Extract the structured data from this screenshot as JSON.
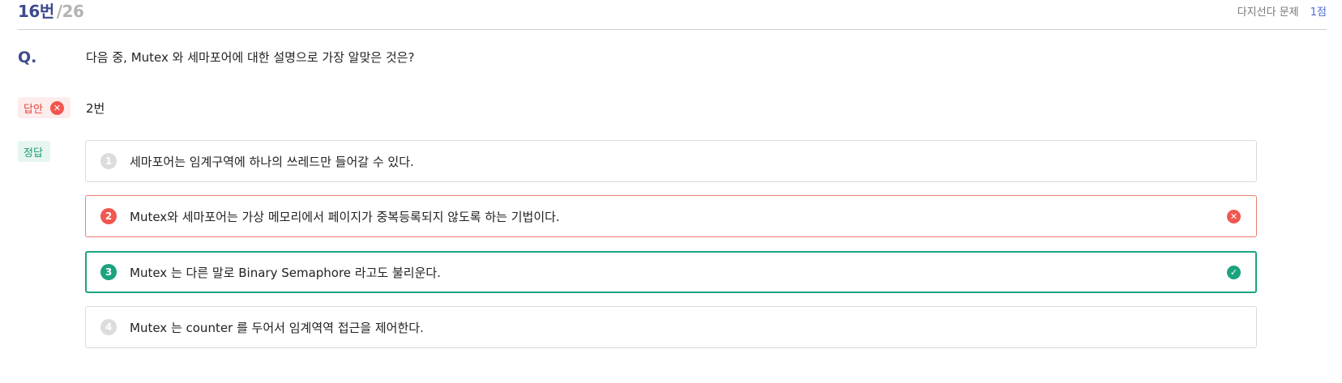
{
  "header": {
    "question_number": "16번",
    "total": "/26",
    "question_type": "다지선다 문제",
    "points": "1점"
  },
  "question": {
    "label": "Q.",
    "text": "다음 중, Mutex 와 세마포어에 대한 설명으로 가장 알맞은 것은?"
  },
  "my_answer": {
    "label": "답안",
    "value": "2번",
    "status_icon": "x-circle-icon"
  },
  "correct": {
    "label": "정답"
  },
  "options": [
    {
      "num": "1",
      "text": "세마포어는 임계구역에 하나의 쓰레드만 들어갈 수 있다.",
      "state": "neutral"
    },
    {
      "num": "2",
      "text": "Mutex와 세마포어는 가상 메모리에서 페이지가 중복등록되지 않도록 하는 기법이다.",
      "state": "wrong"
    },
    {
      "num": "3",
      "text": "Mutex 는 다른 말로 Binary Semaphore 라고도 불리운다.",
      "state": "correct"
    },
    {
      "num": "4",
      "text": "Mutex 는 counter 를 두어서 임계역역 접근을 제어한다.",
      "state": "neutral"
    }
  ],
  "colors": {
    "accent": "#3d4a8f",
    "wrong": "#f2574f",
    "correct": "#1aa37f"
  }
}
